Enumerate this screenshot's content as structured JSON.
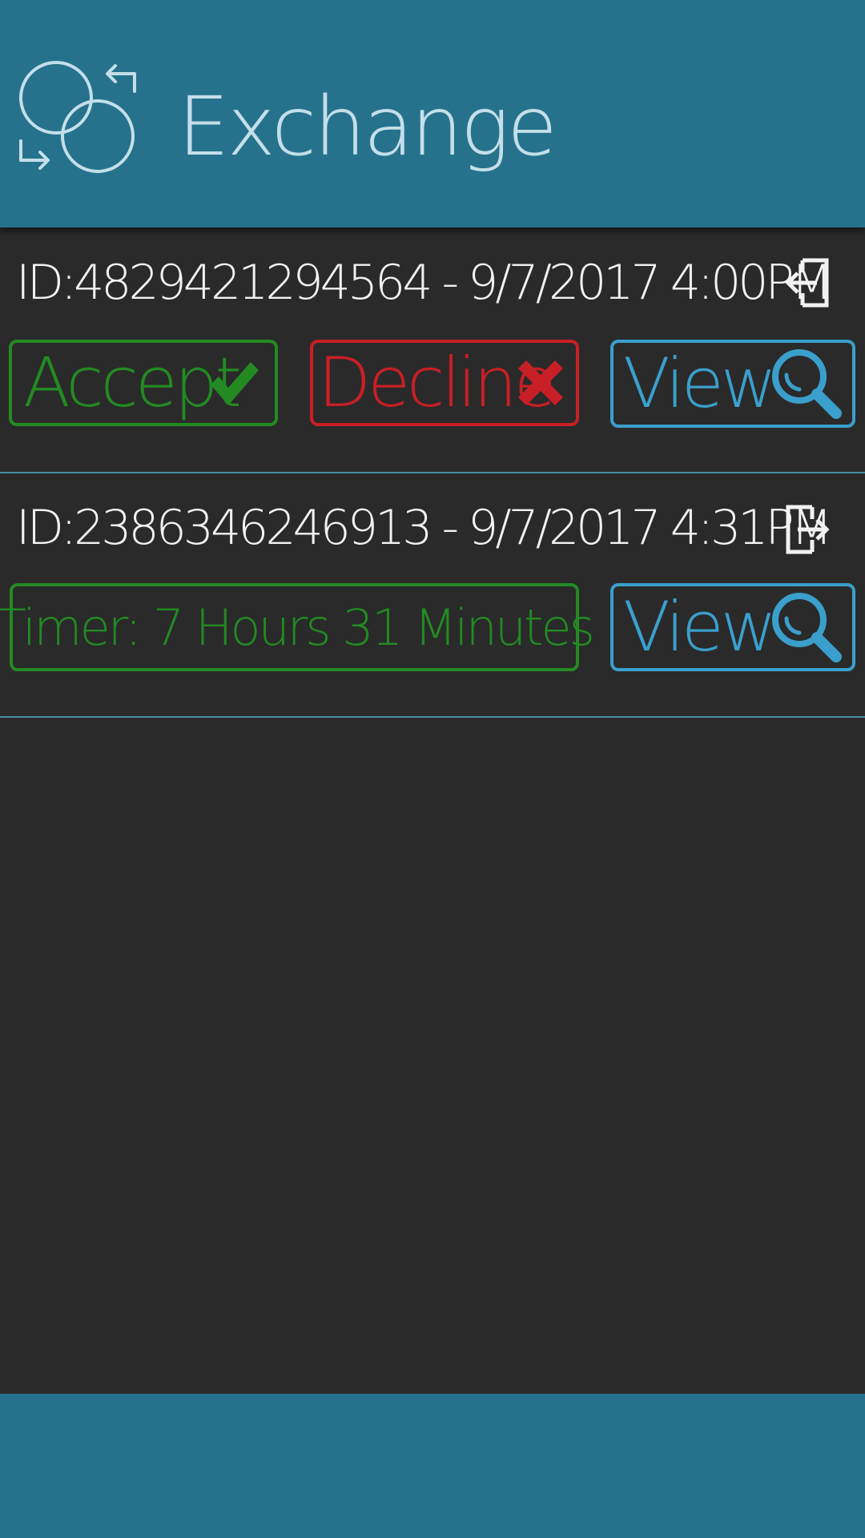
{
  "header": {
    "title": "Exchange",
    "icon": "exchange-icon"
  },
  "colors": {
    "header_bg": "#26728c",
    "body_bg": "#2a2a2a",
    "accept": "#238a23",
    "decline": "#c81f26",
    "view": "#3a9fcc",
    "divider": "#4a8ea6"
  },
  "exchanges": [
    {
      "label": "ID:4829421294564 - 9/7/2017 4:00PM",
      "direction_icon": "incoming-icon",
      "accept_label": "Accept",
      "accept_icon": "checkmark-icon",
      "decline_label": "Decline",
      "decline_icon": "x-icon",
      "view_label": "View",
      "view_icon": "search-icon"
    },
    {
      "label": "ID:2386346246913 - 9/7/2017 4:31PM",
      "direction_icon": "outgoing-icon",
      "timer": "Timer: 7 Hours 31 Minutes",
      "view_label": "View",
      "view_icon": "search-icon"
    }
  ]
}
